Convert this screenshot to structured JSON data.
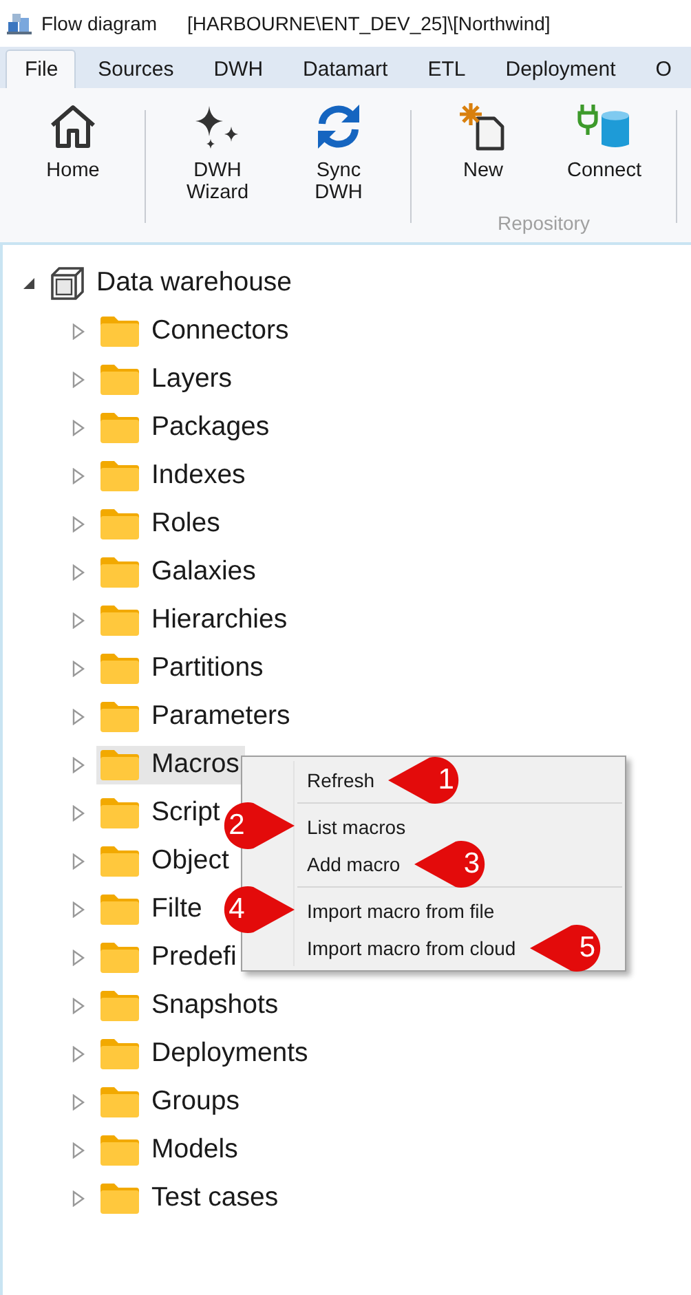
{
  "window": {
    "title": "Flow diagram",
    "subtitle": "[HARBOURNE\\ENT_DEV_25]\\[Northwind]"
  },
  "tabs": [
    {
      "label": "File",
      "selected": true
    },
    {
      "label": "Sources",
      "selected": false
    },
    {
      "label": "DWH",
      "selected": false
    },
    {
      "label": "Datamart",
      "selected": false
    },
    {
      "label": "ETL",
      "selected": false
    },
    {
      "label": "Deployment",
      "selected": false
    },
    {
      "label": "O",
      "selected": false
    }
  ],
  "ribbon": {
    "groups": [
      {
        "buttons": [
          {
            "label": "Home",
            "kind": "home"
          }
        ]
      },
      {
        "buttons": [
          {
            "label": "DWH\nWizard",
            "kind": "wizard"
          },
          {
            "label": "Sync\nDWH",
            "kind": "sync"
          }
        ]
      },
      {
        "label": "Repository",
        "buttons": [
          {
            "label": "New",
            "kind": "new"
          },
          {
            "label": "Connect",
            "kind": "connect"
          }
        ]
      }
    ]
  },
  "tree": {
    "label": "Data warehouse",
    "expanded": true,
    "selected": false,
    "children": [
      {
        "label": "Connectors",
        "expanded": false,
        "selected": false
      },
      {
        "label": "Layers",
        "expanded": false,
        "selected": false
      },
      {
        "label": "Packages",
        "expanded": false,
        "selected": false
      },
      {
        "label": "Indexes",
        "expanded": false,
        "selected": false
      },
      {
        "label": "Roles",
        "expanded": false,
        "selected": false
      },
      {
        "label": "Galaxies",
        "expanded": false,
        "selected": false
      },
      {
        "label": "Hierarchies",
        "expanded": false,
        "selected": false
      },
      {
        "label": "Partitions",
        "expanded": false,
        "selected": false
      },
      {
        "label": "Parameters",
        "expanded": false,
        "selected": false
      },
      {
        "label": "Macros",
        "expanded": false,
        "selected": true
      },
      {
        "label": "Script",
        "expanded": false,
        "selected": false
      },
      {
        "label": "Object",
        "expanded": false,
        "selected": false
      },
      {
        "label": "Filte",
        "expanded": false,
        "selected": false
      },
      {
        "label": "Predefi",
        "expanded": false,
        "selected": false
      },
      {
        "label": "Snapshots",
        "expanded": false,
        "selected": false
      },
      {
        "label": "Deployments",
        "expanded": false,
        "selected": false
      },
      {
        "label": "Groups",
        "expanded": false,
        "selected": false
      },
      {
        "label": "Models",
        "expanded": false,
        "selected": false
      },
      {
        "label": "Test cases",
        "expanded": false,
        "selected": false
      }
    ]
  },
  "context_menu": [
    {
      "kind": "item",
      "label": "Refresh",
      "callout": {
        "label": "1",
        "kind": "points_left"
      }
    },
    {
      "kind": "separator"
    },
    {
      "kind": "item",
      "label": "List macros",
      "callout": {
        "label": "2",
        "kind": "points_right"
      }
    },
    {
      "kind": "item",
      "label": "Add macro",
      "callout": {
        "label": "3",
        "kind": "points_left"
      }
    },
    {
      "kind": "separator"
    },
    {
      "kind": "item",
      "label": "Import macro from file",
      "callout": {
        "label": "4",
        "kind": "points_right"
      }
    },
    {
      "kind": "item",
      "label": "Import macro from cloud",
      "callout": {
        "label": "5",
        "kind": "points_left"
      }
    }
  ]
}
